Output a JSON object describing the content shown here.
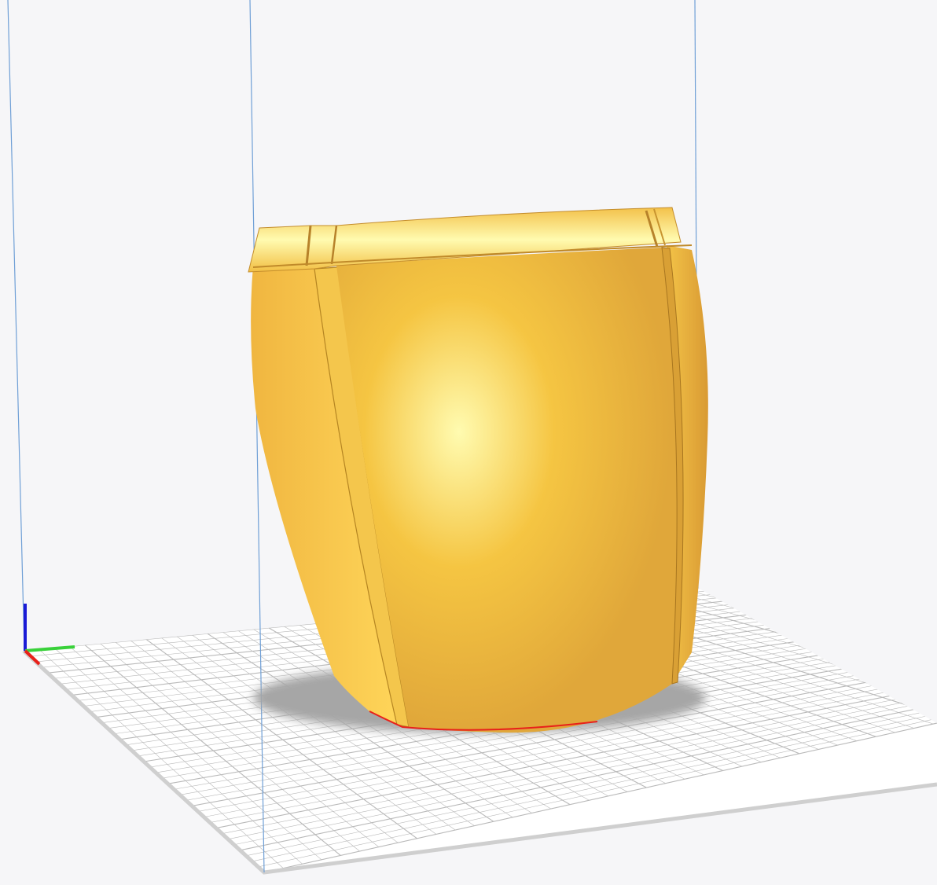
{
  "viewport": {
    "background": "#f6f6f8",
    "build_plate": {
      "fill": "#ffffff",
      "grid_color": "#b9b9b9",
      "edge_color": "#cfcfcf",
      "shadow_color": "#a6a6a6"
    },
    "build_volume": {
      "line_color": "#6f9fd6"
    },
    "model": {
      "color_base": "#f5c542",
      "color_highlight": "#fffbb0",
      "color_shade": "#e0a73a",
      "bottom_edge_color": "#e8201a"
    },
    "axis_indicator": {
      "x_color": "#e8201a",
      "y_color": "#39d13a",
      "z_color": "#1a1ad6"
    }
  }
}
